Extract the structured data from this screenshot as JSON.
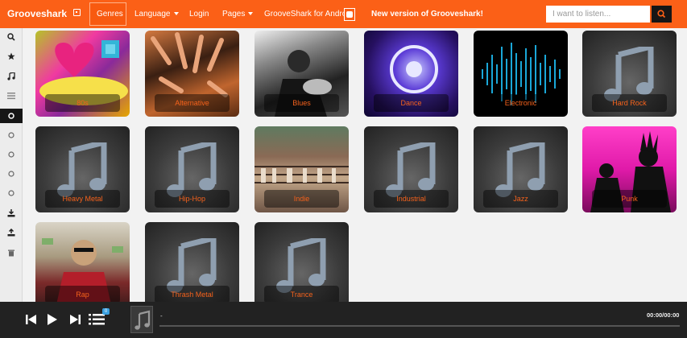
{
  "navbar": {
    "brand": "Grooveshark",
    "items": [
      {
        "label": "Genres"
      },
      {
        "label": "Language"
      },
      {
        "label": "Login"
      },
      {
        "label": "Pages"
      },
      {
        "label": "GrooveShark for Android"
      }
    ],
    "news": "New version of Grooveshark!",
    "search_placeholder": "I want to listen..."
  },
  "genres": [
    {
      "label": "80s"
    },
    {
      "label": "Alternative"
    },
    {
      "label": "Blues"
    },
    {
      "label": "Dance"
    },
    {
      "label": "Electronic"
    },
    {
      "label": "Hard Rock"
    },
    {
      "label": "Heavy Metal"
    },
    {
      "label": "Hip-Hop"
    },
    {
      "label": "Indie"
    },
    {
      "label": "Industrial"
    },
    {
      "label": "Jazz"
    },
    {
      "label": "Punk"
    },
    {
      "label": "Rap"
    },
    {
      "label": "Thrash Metal"
    },
    {
      "label": "Trance"
    }
  ],
  "player": {
    "track_title": "-",
    "time": "00:00/00:00",
    "queue_count": "0"
  },
  "colors": {
    "accent": "#fb6017",
    "label_text": "#f5621c"
  }
}
